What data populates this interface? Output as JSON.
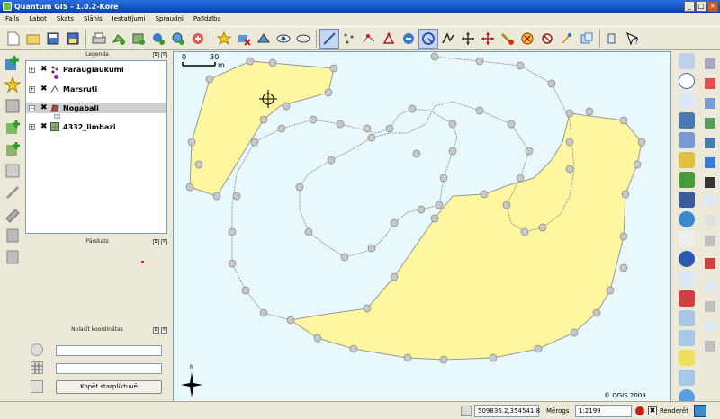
{
  "window": {
    "title": "Quantum GIS - 1.0.2-Kore",
    "controls": [
      "_",
      "□",
      "×"
    ]
  },
  "menu": [
    "Fails",
    "Labot",
    "Skats",
    "Slānis",
    "Iestatījumi",
    "Spraudņi",
    "Palīdzība"
  ],
  "toolbar_icons": [
    "new-project-icon",
    "open-project-icon",
    "save-project-icon",
    "save-as-icon",
    "print-icon",
    "add-vector-layer-icon",
    "add-raster-layer-icon",
    "add-postgis-layer-icon",
    "add-wms-layer-icon",
    "new-vector-layer-icon",
    "add-wfs-layer-icon",
    "remove-layer-icon",
    "toggle-editing-icon",
    "show-all-icon",
    "hide-all-icon",
    "capture-line-icon",
    "capture-point-icon",
    "add-vertex-icon",
    "move-vertex-icon",
    "node-tool-icon",
    "split-feature-icon",
    "delete-vertex-icon",
    "move-feature-icon",
    "cut-icon",
    "delete-selected-icon",
    "copy-features-icon",
    "paste-features-icon",
    "add-ring-icon",
    "add-island-icon",
    "whats-this-icon"
  ],
  "legend": {
    "title": "Leģenda",
    "layers": [
      {
        "name": "Paraugiaukumi",
        "expanded": "+",
        "checked": true,
        "icon": "point-layer-icon"
      },
      {
        "name": "Marsruti",
        "expanded": "+",
        "checked": true,
        "icon": "line-layer-icon"
      },
      {
        "name": "Nogabali",
        "expanded": "−",
        "checked": true,
        "icon": "polygon-layer-icon",
        "selected": true
      },
      {
        "name": "4332_limbazi",
        "expanded": "+",
        "checked": true,
        "icon": "raster-layer-icon"
      }
    ]
  },
  "overview": {
    "title": "Pārskats"
  },
  "coordinates": {
    "title": "Nolasīt koordinātas",
    "copy_button": "Kopēt starpliktuvē",
    "field1": "",
    "field2": ""
  },
  "map": {
    "scalebar_start": "0",
    "scalebar_end": "30",
    "scalebar_unit": "m",
    "copyright": "© QGIS 2009",
    "north_label": "N"
  },
  "status": {
    "coordinates": "509836.2,354541.8",
    "scale_label": "Mērogs",
    "scale_value": "1:2199",
    "render_label": "Renderēt",
    "render_checked": true
  },
  "colors": {
    "polygon_fill": "#fef79f",
    "polygon_stroke": "#999999",
    "map_bg": "#e8f8fb",
    "vertex_fill": "#c8c8c8"
  }
}
